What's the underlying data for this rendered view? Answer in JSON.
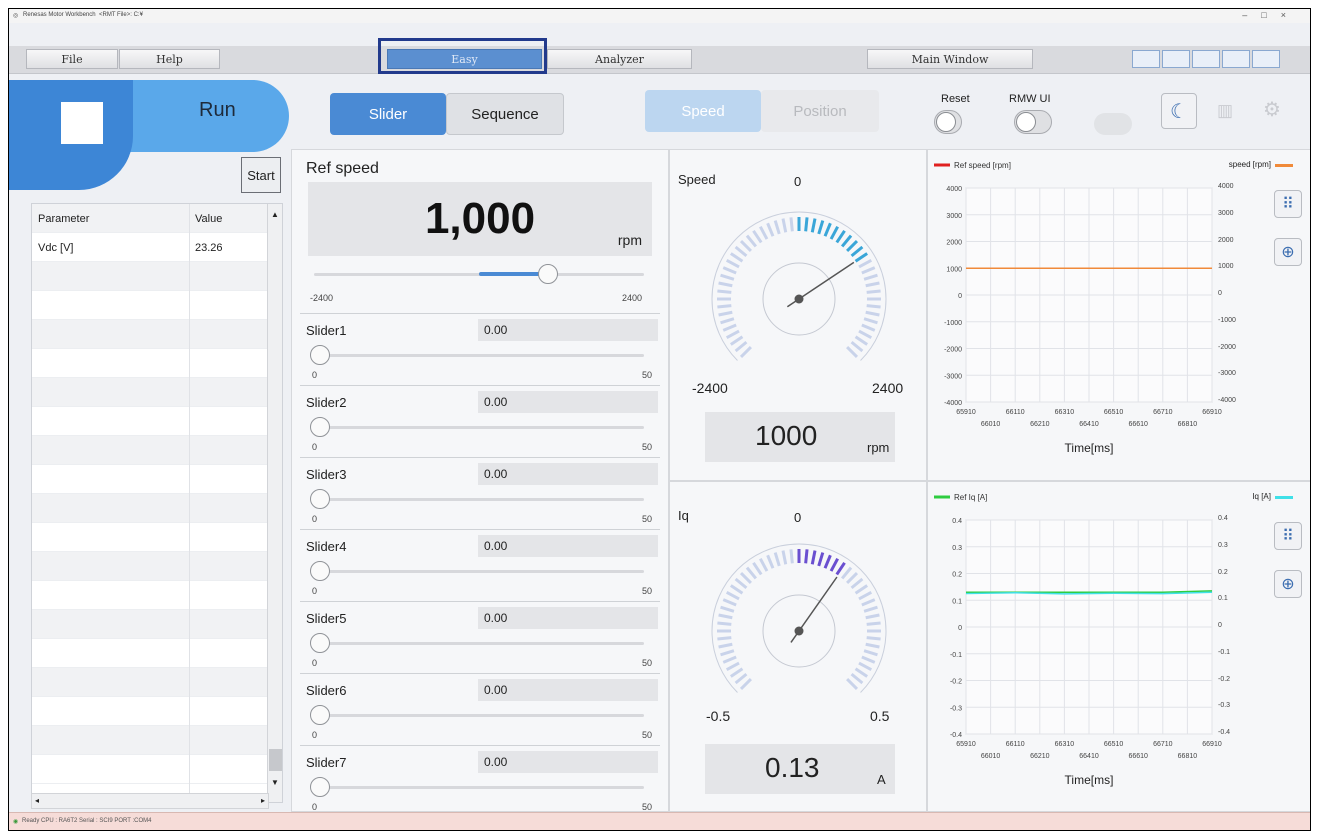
{
  "titlebar": {
    "app": "Renesas Motor Workbench",
    "file": "<RMT File>: C:¥"
  },
  "menu": {
    "file": "File",
    "help": "Help",
    "easy": "Easy",
    "analyzer": "Analyzer",
    "main_window": "Main Window"
  },
  "run": {
    "label": "Run",
    "start": "Start"
  },
  "mode_tabs": {
    "slider": "Slider",
    "sequence": "Sequence",
    "speed": "Speed",
    "position": "Position"
  },
  "toggles": {
    "reset": "Reset",
    "rmw_ui": "RMW UI"
  },
  "param_table": {
    "headers": [
      "Parameter",
      "Value"
    ],
    "rows": [
      {
        "name": "Vdc [V]",
        "value": "23.26"
      }
    ]
  },
  "ref_speed": {
    "label": "Ref speed",
    "value": "1,000",
    "unit": "rpm",
    "min": "-2400",
    "max": "2400",
    "fraction": 0.71
  },
  "sliders": [
    {
      "label": "Slider1",
      "value": "0.00",
      "min": "0",
      "max": "50"
    },
    {
      "label": "Slider2",
      "value": "0.00",
      "min": "0",
      "max": "50"
    },
    {
      "label": "Slider3",
      "value": "0.00",
      "min": "0",
      "max": "50"
    },
    {
      "label": "Slider4",
      "value": "0.00",
      "min": "0",
      "max": "50"
    },
    {
      "label": "Slider5",
      "value": "0.00",
      "min": "0",
      "max": "50"
    },
    {
      "label": "Slider6",
      "value": "0.00",
      "min": "0",
      "max": "50"
    },
    {
      "label": "Slider7",
      "value": "0.00",
      "min": "0",
      "max": "50"
    }
  ],
  "gauges": {
    "speed": {
      "title": "Speed",
      "zero": "0",
      "min": "-2400",
      "max": "2400",
      "value": "1000",
      "unit": "rpm",
      "min_val": -2400,
      "max_val": 2400,
      "val": 1000
    },
    "iq": {
      "title": "Iq",
      "zero": "0",
      "min": "-0.5",
      "max": "0.5",
      "value": "0.13",
      "unit": "A",
      "min_val": -0.5,
      "max_val": 0.5,
      "val": 0.13
    }
  },
  "chart_data": [
    {
      "type": "line",
      "legend_left": "Ref speed [rpm]",
      "legend_right": "speed [rpm]",
      "xlabel": "Time[ms]",
      "x_ticks_top": [
        "65910",
        "66110",
        "66310",
        "66510",
        "66710",
        "66910"
      ],
      "x_ticks_bottom": [
        "66010",
        "66210",
        "66410",
        "66610",
        "66810"
      ],
      "y_ticks": [
        "4000",
        "3000",
        "2000",
        "1000",
        "0",
        "-1000",
        "-2000",
        "-3000",
        "-4000"
      ],
      "xlim": [
        65910,
        66910
      ],
      "ylim": [
        -4000,
        4000
      ],
      "series": [
        {
          "name": "Ref speed [rpm]",
          "color": "#e02020",
          "x": [
            65910,
            66910
          ],
          "y": [
            1000,
            1000
          ]
        },
        {
          "name": "speed [rpm]",
          "color": "#f08a3a",
          "x": [
            65910,
            66910
          ],
          "y": [
            1000,
            1000
          ]
        }
      ]
    },
    {
      "type": "line",
      "legend_left": "Ref Iq [A]",
      "legend_right": "Iq [A]",
      "xlabel": "Time[ms]",
      "x_ticks_top": [
        "65910",
        "66110",
        "66310",
        "66510",
        "66710",
        "66910"
      ],
      "x_ticks_bottom": [
        "66010",
        "66210",
        "66410",
        "66610",
        "66810"
      ],
      "y_ticks": [
        "0.4",
        "0.3",
        "0.2",
        "0.1",
        "0",
        "-0.1",
        "-0.2",
        "-0.3",
        "-0.4"
      ],
      "xlim": [
        65910,
        66910
      ],
      "ylim": [
        -0.4,
        0.4
      ],
      "series": [
        {
          "name": "Ref Iq [A]",
          "color": "#2ecc40",
          "x": [
            65910,
            66110,
            66310,
            66510,
            66710,
            66910
          ],
          "y": [
            0.13,
            0.13,
            0.13,
            0.13,
            0.13,
            0.135
          ]
        },
        {
          "name": "Iq [A]",
          "color": "#40e0e8",
          "x": [
            65910,
            66110,
            66310,
            66510,
            66710,
            66910
          ],
          "y": [
            0.125,
            0.128,
            0.124,
            0.126,
            0.125,
            0.13
          ]
        }
      ]
    }
  ],
  "status": {
    "text": "Ready  CPU : RA6T2 Serial : SCI9  PORT :COM4"
  },
  "colors": {
    "accent": "#5aa8ea",
    "run_dark": "#3d86d6",
    "speed_arc": "#3aa6d8",
    "iq_arc": "#6a4fd0"
  }
}
